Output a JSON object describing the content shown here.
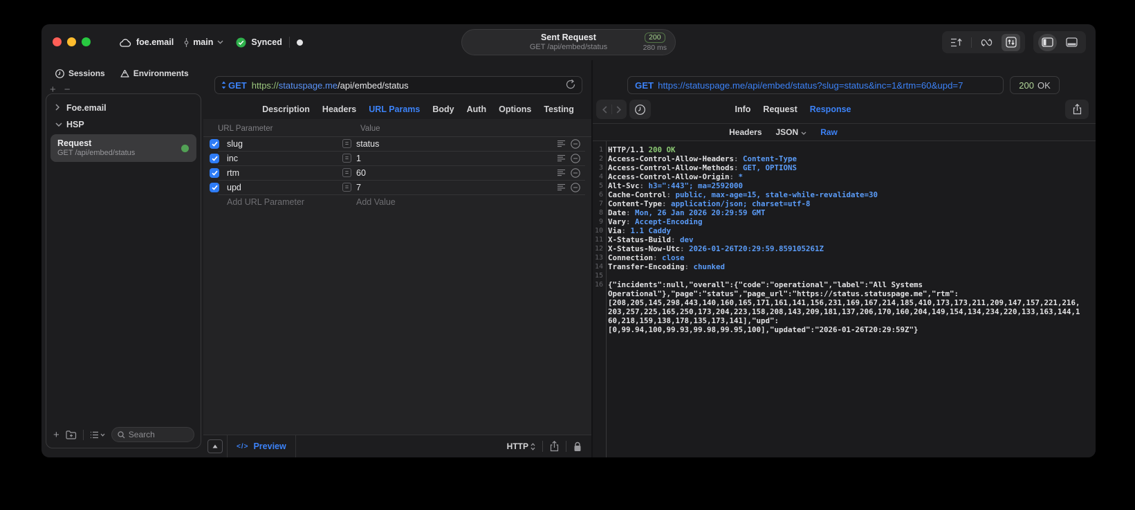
{
  "titlebar": {
    "project_name": "foe.email",
    "branch_name": "main",
    "sync_label": "Synced",
    "request_pill": {
      "title": "Sent Request",
      "subtitle": "GET /api/embed/status",
      "status_code": "200",
      "duration": "280 ms"
    }
  },
  "sidebar": {
    "tabs": [
      {
        "label": "Sessions"
      },
      {
        "label": "Environments"
      }
    ],
    "tree": [
      {
        "label": "Foe.email",
        "expanded": false
      },
      {
        "label": "HSP",
        "expanded": true
      }
    ],
    "request_item": {
      "title": "Request",
      "subtitle": "GET /api/embed/status"
    },
    "search_placeholder": "Search"
  },
  "request_editor": {
    "method": "GET",
    "url": {
      "scheme": "https://",
      "host": "statuspage.me",
      "path": "/api/embed/status"
    },
    "tabs": [
      "Description",
      "Headers",
      "URL Params",
      "Body",
      "Auth",
      "Options",
      "Testing"
    ],
    "active_tab": "URL Params",
    "params_table": {
      "columns": [
        "URL Parameter",
        "Value"
      ],
      "rows": [
        {
          "checked": true,
          "name": "slug",
          "value": "status"
        },
        {
          "checked": true,
          "name": "inc",
          "value": "1"
        },
        {
          "checked": true,
          "name": "rtm",
          "value": "60"
        },
        {
          "checked": true,
          "name": "upd",
          "value": "7"
        }
      ],
      "add_name_placeholder": "Add URL Parameter",
      "add_value_placeholder": "Add Value"
    },
    "footer": {
      "preview_label": "Preview",
      "protocol_label": "HTTP"
    }
  },
  "response_viewer": {
    "request_line": {
      "method": "GET",
      "url": "https://statuspage.me/api/embed/status?slug=status&inc=1&rtm=60&upd=7"
    },
    "status": {
      "code": "200",
      "reason": "OK"
    },
    "tabs": [
      "Info",
      "Request",
      "Response"
    ],
    "active_tab": "Response",
    "subtabs": [
      "Headers",
      "JSON",
      "Raw"
    ],
    "active_subtab": "Raw",
    "code_lines": [
      {
        "n": "1",
        "segs": [
          {
            "t": "HTTP/1.1 ",
            "c": "w"
          },
          {
            "t": "200 OK",
            "c": "g"
          }
        ]
      },
      {
        "n": "2",
        "segs": [
          {
            "t": "Access-Control-Allow-Headers",
            "c": "w"
          },
          {
            "t": ": ",
            "c": "d"
          },
          {
            "t": "Content-Type",
            "c": "b"
          }
        ]
      },
      {
        "n": "3",
        "segs": [
          {
            "t": "Access-Control-Allow-Methods",
            "c": "w"
          },
          {
            "t": ": ",
            "c": "d"
          },
          {
            "t": "GET, OPTIONS",
            "c": "b"
          }
        ]
      },
      {
        "n": "4",
        "segs": [
          {
            "t": "Access-Control-Allow-Origin",
            "c": "w"
          },
          {
            "t": ": ",
            "c": "d"
          },
          {
            "t": "*",
            "c": "b"
          }
        ]
      },
      {
        "n": "5",
        "segs": [
          {
            "t": "Alt-Svc",
            "c": "w"
          },
          {
            "t": ": ",
            "c": "d"
          },
          {
            "t": "h3=\":443\"; ma=2592000",
            "c": "b"
          }
        ]
      },
      {
        "n": "6",
        "segs": [
          {
            "t": "Cache-Control",
            "c": "w"
          },
          {
            "t": ": ",
            "c": "d"
          },
          {
            "t": "public, max-age=15, stale-while-revalidate=30",
            "c": "b"
          }
        ]
      },
      {
        "n": "7",
        "segs": [
          {
            "t": "Content-Type",
            "c": "w"
          },
          {
            "t": ": ",
            "c": "d"
          },
          {
            "t": "application/json; charset=utf-8",
            "c": "b"
          }
        ]
      },
      {
        "n": "8",
        "segs": [
          {
            "t": "Date",
            "c": "w"
          },
          {
            "t": ": ",
            "c": "d"
          },
          {
            "t": "Mon, 26 Jan 2026 20:29:59 GMT",
            "c": "b"
          }
        ]
      },
      {
        "n": "9",
        "segs": [
          {
            "t": "Vary",
            "c": "w"
          },
          {
            "t": ": ",
            "c": "d"
          },
          {
            "t": "Accept-Encoding",
            "c": "b"
          }
        ]
      },
      {
        "n": "10",
        "segs": [
          {
            "t": "Via",
            "c": "w"
          },
          {
            "t": ": ",
            "c": "d"
          },
          {
            "t": "1.1 Caddy",
            "c": "b"
          }
        ]
      },
      {
        "n": "11",
        "segs": [
          {
            "t": "X-Status-Build",
            "c": "w"
          },
          {
            "t": ": ",
            "c": "d"
          },
          {
            "t": "dev",
            "c": "b"
          }
        ]
      },
      {
        "n": "12",
        "segs": [
          {
            "t": "X-Status-Now-Utc",
            "c": "w"
          },
          {
            "t": ": ",
            "c": "d"
          },
          {
            "t": "2026-01-26T20:29:59.859105261Z",
            "c": "b"
          }
        ]
      },
      {
        "n": "13",
        "segs": [
          {
            "t": "Connection",
            "c": "w"
          },
          {
            "t": ": ",
            "c": "d"
          },
          {
            "t": "close",
            "c": "b"
          }
        ]
      },
      {
        "n": "14",
        "segs": [
          {
            "t": "Transfer-Encoding",
            "c": "w"
          },
          {
            "t": ": ",
            "c": "d"
          },
          {
            "t": "chunked",
            "c": "b"
          }
        ]
      },
      {
        "n": "15",
        "segs": []
      },
      {
        "n": "16",
        "body": true
      }
    ],
    "body_lines": [
      "{\"incidents\":null,\"overall\":{\"code\":\"operational\",\"label\":\"All Systems",
      "Operational\"},\"page\":\"status\",\"page_url\":\"https://status.statuspage.me\",\"rtm\":",
      "[208,205,145,298,443,140,160,165,171,161,141,156,231,169,167,214,185,410,173,173,211,209,147,157,221,216,",
      "203,257,225,165,250,173,204,223,158,208,143,209,181,137,206,170,160,204,149,154,134,234,220,133,163,144,1",
      "60,218,159,138,178,135,173,141],\"upd\":",
      "[0,99.94,100,99.93,99.98,99.95,100],\"updated\":\"2026-01-26T20:29:59Z\"}"
    ]
  }
}
